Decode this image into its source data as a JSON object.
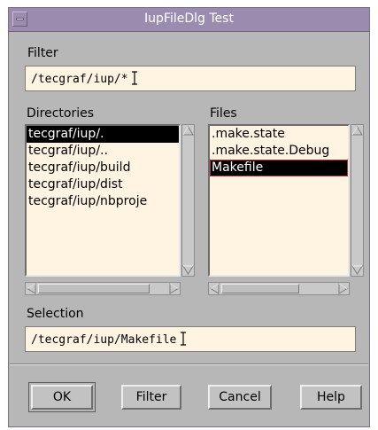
{
  "window": {
    "title": "IupFileDlg Test"
  },
  "filter": {
    "label": "Filter",
    "value": "/tecgraf/iup/*"
  },
  "directories": {
    "label": "Directories",
    "items": [
      "tecgraf/iup/.",
      "tecgraf/iup/..",
      "tecgraf/iup/build",
      "tecgraf/iup/dist",
      "tecgraf/iup/nbproje"
    ],
    "selected_index": 0
  },
  "files": {
    "label": "Files",
    "items": [
      ".make.state",
      ".make.state.Debug",
      "Makefile"
    ],
    "selected_index": 2
  },
  "selection": {
    "label": "Selection",
    "value": "/tecgraf/iup/Makefile"
  },
  "buttons": {
    "ok": "OK",
    "filter": "Filter",
    "cancel": "Cancel",
    "help": "Help"
  },
  "colors": {
    "titlebar": "#9a8cae",
    "dialog_bg": "#b7b7b7",
    "field_bg": "#fff4e2",
    "selected_bg": "#000000",
    "focus_outline": "#b0333a"
  },
  "icons": {
    "window_menu": "window-menu-icon",
    "scroll_up": "arrow-up-icon",
    "scroll_down": "arrow-down-icon",
    "scroll_left": "arrow-left-icon",
    "scroll_right": "arrow-right-icon",
    "text_cursor": "ibeam-cursor-icon"
  }
}
